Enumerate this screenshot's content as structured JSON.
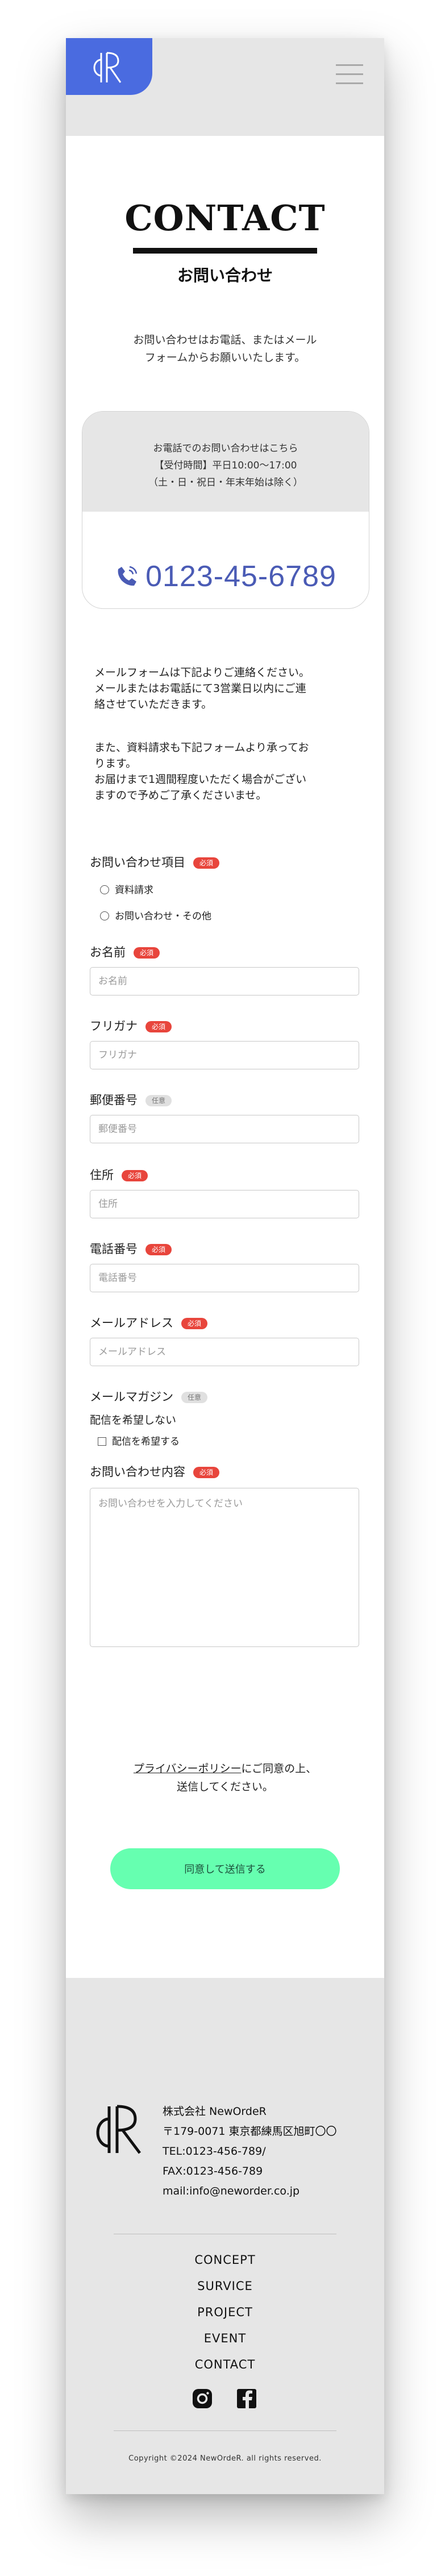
{
  "header": {
    "logo_alt": "dR",
    "menu_icon": "hamburger-icon"
  },
  "hero": {
    "title": "CONTACT",
    "subtitle": "お問い合わせ",
    "intro_line1": "お問い合わせはお電話、またはメール",
    "intro_line2": "フォームからお願いいたします。"
  },
  "phone_card": {
    "line1": "お電話でのお問い合わせはこちら",
    "line2": "【受付時間】平日10:00～17:00",
    "line3": "（土・日・祝日・年末年始は除く）",
    "phone_icon": "phone-icon",
    "phone_number": "0123-45-6789"
  },
  "notes": {
    "para1_line1": "メールフォームは下記よりご連絡ください。",
    "para1_line2": "メールまたはお電話にて3営業日以内にご連",
    "para1_line3": "絡させていただきます。",
    "para2_line1": "また、資料請求も下記フォームより承ってお",
    "para2_line2": "ります。",
    "para2_line3": "お届けまで1週間程度いただく場合がござい",
    "para2_line4": "ますので予めご了承くださいませ。"
  },
  "form": {
    "required_badge": "必須",
    "optional_badge": "任意",
    "inquiry_type_label": "お問い合わせ項目",
    "inquiry_options": [
      "資料請求",
      "お問い合わせ・その他"
    ],
    "name_label": "お名前",
    "name_placeholder": "お名前",
    "furigana_label": "フリガナ",
    "furigana_placeholder": "フリガナ",
    "zip_label": "郵便番号",
    "zip_placeholder": "郵便番号",
    "address_label": "住所",
    "address_placeholder": "住所",
    "phone_label": "電話番号",
    "phone_placeholder": "電話番号",
    "email_label": "メールアドレス",
    "email_placeholder": "メールアドレス",
    "magazine_label": "メールマガジン",
    "magazine_value": "配信を希望しない",
    "magazine_checkbox_label": "配信を希望する",
    "message_label": "お問い合わせ内容",
    "message_placeholder": "お問い合わせを入力してください",
    "privacy_link": "プライバシーポリシー",
    "privacy_text": "にご同意の上、",
    "privacy_text2": "送信してください。",
    "submit_label": "同意して送信する"
  },
  "footer": {
    "company_name": "株式会社 NewOrdeR",
    "address": "〒179-0071 東京都練馬区旭町〇〇",
    "tel": "TEL:0123-456-789/",
    "fax": "FAX:0123-456-789",
    "mail": "mail:info@neworder.co.jp",
    "nav": [
      "CONCEPT",
      "SURVICE",
      "PROJECT",
      "EVENT",
      "CONTACT"
    ],
    "social_icons": [
      "instagram-icon",
      "facebook-icon"
    ],
    "copyright": "Copyright ©2024 NewOrdeR. all rights reserved."
  },
  "colors": {
    "accent_blue": "#4a6be0",
    "phone_blue": "#4a5bb5",
    "required_red": "#e8453c",
    "submit_green": "#66ffb0",
    "header_gray": "#e6e6e6"
  }
}
